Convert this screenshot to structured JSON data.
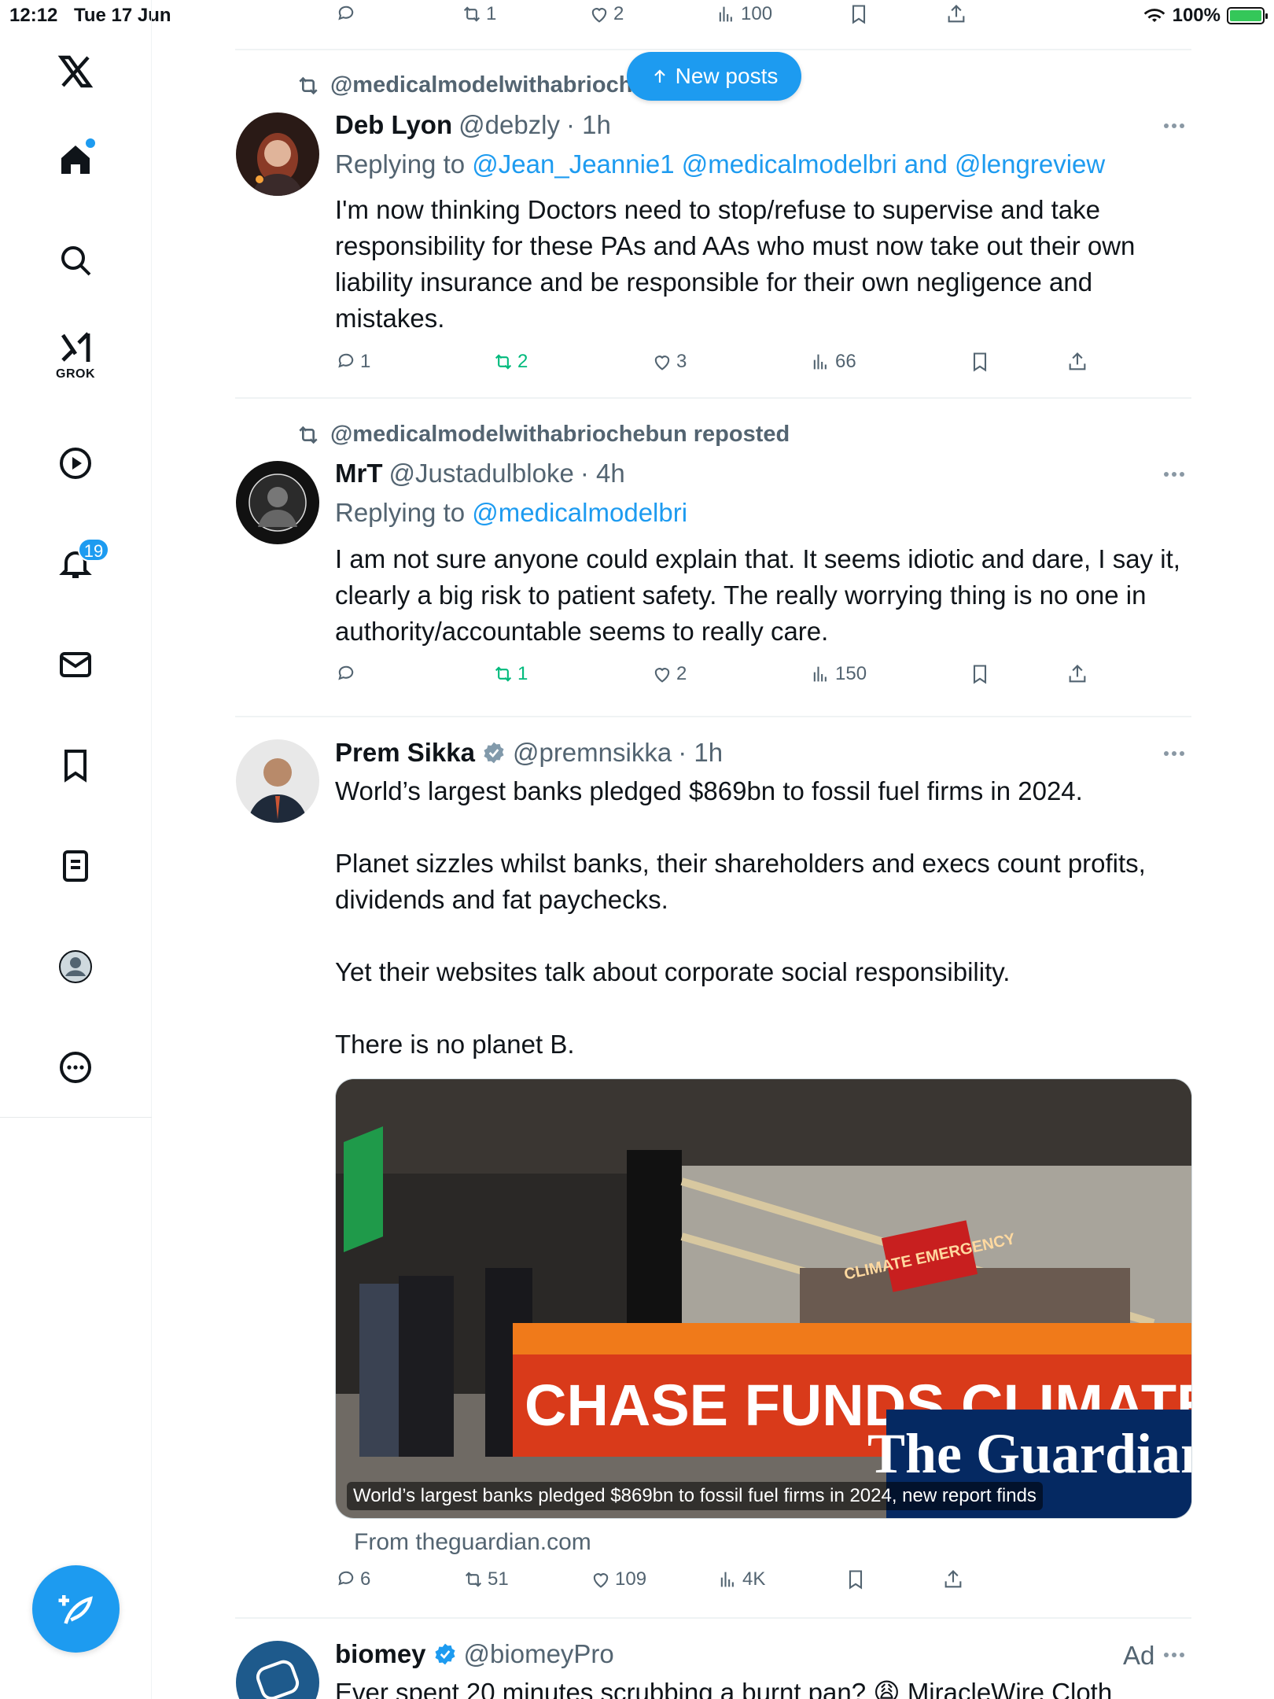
{
  "status_bar": {
    "time": "12:12",
    "date": "Tue 17 Jun",
    "battery": "100%"
  },
  "top_bar": {
    "retweets": "1",
    "likes": "2",
    "views": "100"
  },
  "new_posts_label": "New posts",
  "sidebar": {
    "notifications_badge": "19",
    "grok_label": "GROK"
  },
  "posts": [
    {
      "reposted_by": "@medicalmodelwithabriochebun reposted",
      "name": "Deb Lyon",
      "handle": "@debzly",
      "time": "· 1h",
      "replying_prefix": "Replying to",
      "replying_to": "@Jean_Jeannie1 @medicalmodelbri and @lengreview",
      "text": "I'm now thinking Doctors need to stop/refuse to supervise and take responsibility for these PAs and AAs who must now take out their own liability insurance and be responsible for their own negligence and mistakes.",
      "replies": "1",
      "retweets": "2",
      "likes": "3",
      "views": "66"
    },
    {
      "reposted_by": "@medicalmodelwithabriochebun reposted",
      "name": "MrT",
      "handle": "@Justadulbloke",
      "time": "· 4h",
      "replying_prefix": "Replying to",
      "replying_to": "@medicalmodelbri",
      "text": "I am not sure anyone could explain that.  It seems idiotic and dare, I say it, clearly a big risk to patient safety.  The really worrying thing is no one in authority/accountable seems to really care.",
      "replies": "",
      "retweets": "1",
      "likes": "2",
      "views": "150"
    },
    {
      "name": "Prem Sikka",
      "handle": "@premnsikka",
      "time": "· 1h",
      "text": "World’s largest banks pledged $869bn to fossil fuel firms in 2024.\n\nPlanet sizzles whilst banks, their shareholders and execs count profits, dividends and fat paychecks.\n\nYet their websites talk about corporate social responsibility.\n\nThere is no planet B.",
      "media_caption": "World’s largest banks pledged $869bn to fossil fuel firms in 2024, new report finds",
      "banner_text": "CHASE FUNDS CLIMATE CRIMES",
      "sign_text": "CLIMATE EMERGENCY",
      "source_logo": "The Guardian",
      "from": "From theguardian.com",
      "replies": "6",
      "retweets": "51",
      "likes": "109",
      "views": "4K"
    },
    {
      "name": "biomey",
      "handle": "@biomeyPro",
      "ad_label": "Ad",
      "text": "Ever spent 20 minutes scrubbing a burnt pan? 😩 MiracleWire Cloth"
    }
  ],
  "colors": {
    "accent": "#1d9bf0",
    "retweet_green": "#00ba7c",
    "muted": "#536471"
  }
}
